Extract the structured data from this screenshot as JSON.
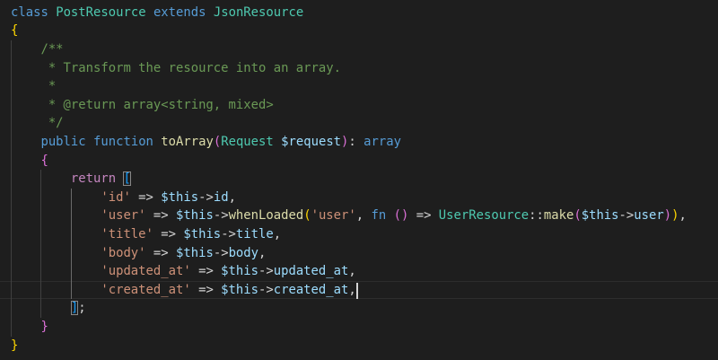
{
  "editor": {
    "theme_colors": {
      "background": "#1e1e1e",
      "keyword": "#569cd6",
      "control": "#c586c0",
      "class": "#4ec9b0",
      "function": "#dcdcaa",
      "variable": "#9cdcfe",
      "string": "#ce9178",
      "comment": "#6a9955",
      "bracket_1": "#ffd700",
      "bracket_2": "#da70d6",
      "bracket_3": "#179fff"
    },
    "cursor": {
      "line": 16
    },
    "lines": [
      [
        [
          "kw",
          "class"
        ],
        [
          "txt",
          " "
        ],
        [
          "cls",
          "PostResource"
        ],
        [
          "txt",
          " "
        ],
        [
          "kw",
          "extends"
        ],
        [
          "txt",
          " "
        ],
        [
          "cls",
          "JsonResource"
        ]
      ],
      [
        [
          "b1",
          "{"
        ]
      ],
      [
        [
          "cmt",
          "    /**"
        ]
      ],
      [
        [
          "cmt",
          "     * Transform the resource into an array."
        ]
      ],
      [
        [
          "cmt",
          "     *"
        ]
      ],
      [
        [
          "cmt",
          "     * @return array<string, mixed>"
        ]
      ],
      [
        [
          "cmt",
          "     */"
        ]
      ],
      [
        [
          "txt",
          "    "
        ],
        [
          "kw",
          "public"
        ],
        [
          "txt",
          " "
        ],
        [
          "kw",
          "function"
        ],
        [
          "txt",
          " "
        ],
        [
          "fn",
          "toArray"
        ],
        [
          "b2",
          "("
        ],
        [
          "cls",
          "Request"
        ],
        [
          "txt",
          " "
        ],
        [
          "var",
          "$request"
        ],
        [
          "b2",
          ")"
        ],
        [
          "txt",
          ": "
        ],
        [
          "kw",
          "array"
        ]
      ],
      [
        [
          "txt",
          "    "
        ],
        [
          "b2",
          "{"
        ]
      ],
      [
        [
          "txt",
          "        "
        ],
        [
          "ctl",
          "return"
        ],
        [
          "txt",
          " "
        ],
        [
          "b3 bm",
          "["
        ]
      ],
      [
        [
          "txt",
          "            "
        ],
        [
          "str",
          "'id'"
        ],
        [
          "txt",
          " => "
        ],
        [
          "var",
          "$this"
        ],
        [
          "txt",
          "->"
        ],
        [
          "var",
          "id"
        ],
        [
          "txt",
          ","
        ]
      ],
      [
        [
          "txt",
          "            "
        ],
        [
          "str",
          "'user'"
        ],
        [
          "txt",
          " => "
        ],
        [
          "var",
          "$this"
        ],
        [
          "txt",
          "->"
        ],
        [
          "fn",
          "whenLoaded"
        ],
        [
          "b1",
          "("
        ],
        [
          "str",
          "'user'"
        ],
        [
          "txt",
          ", "
        ],
        [
          "kw",
          "fn"
        ],
        [
          "txt",
          " "
        ],
        [
          "b2",
          "()"
        ],
        [
          "txt",
          " => "
        ],
        [
          "cls",
          "UserResource"
        ],
        [
          "txt",
          "::"
        ],
        [
          "fn",
          "make"
        ],
        [
          "b2",
          "("
        ],
        [
          "var",
          "$this"
        ],
        [
          "txt",
          "->"
        ],
        [
          "var",
          "user"
        ],
        [
          "b2",
          ")"
        ],
        [
          "b1",
          ")"
        ],
        [
          "txt",
          ","
        ]
      ],
      [
        [
          "txt",
          "            "
        ],
        [
          "str",
          "'title'"
        ],
        [
          "txt",
          " => "
        ],
        [
          "var",
          "$this"
        ],
        [
          "txt",
          "->"
        ],
        [
          "var",
          "title"
        ],
        [
          "txt",
          ","
        ]
      ],
      [
        [
          "txt",
          "            "
        ],
        [
          "str",
          "'body'"
        ],
        [
          "txt",
          " => "
        ],
        [
          "var",
          "$this"
        ],
        [
          "txt",
          "->"
        ],
        [
          "var",
          "body"
        ],
        [
          "txt",
          ","
        ]
      ],
      [
        [
          "txt",
          "            "
        ],
        [
          "str",
          "'updated_at'"
        ],
        [
          "txt",
          " => "
        ],
        [
          "var",
          "$this"
        ],
        [
          "txt",
          "->"
        ],
        [
          "var",
          "updated_at"
        ],
        [
          "txt",
          ","
        ]
      ],
      [
        [
          "txt",
          "            "
        ],
        [
          "str",
          "'created_at'"
        ],
        [
          "txt",
          " => "
        ],
        [
          "var",
          "$this"
        ],
        [
          "txt",
          "->"
        ],
        [
          "var",
          "created_at"
        ],
        [
          "txt",
          ","
        ]
      ],
      [
        [
          "txt",
          "        "
        ],
        [
          "b3 bm",
          "]"
        ],
        [
          "txt",
          ";"
        ]
      ],
      [
        [
          "txt",
          "    "
        ],
        [
          "b2",
          "}"
        ]
      ],
      [
        [
          "b1",
          "}"
        ]
      ]
    ]
  }
}
